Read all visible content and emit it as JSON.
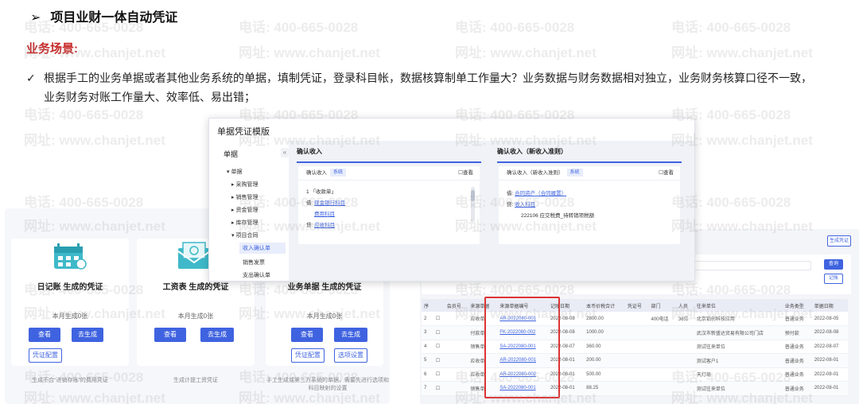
{
  "section_title": "项目业财一体自动凭证",
  "section_arrow": "➢",
  "biz_scene_label": "业务场景:",
  "bullet_check": "✓",
  "bullet_line1": "根据手工的业务单据或者其他业务系统的单据，填制凭证，登录科目帐，数据核算制单工作量大？业务数据与财务数据相对独立，业务财务核算口径不一致，",
  "bullet_line2": "业务财务对账工作量大、效率低、易出错；",
  "watermark": {
    "phone": "电话: 400-665-0028",
    "url": "网址: www.chanjet.net"
  },
  "dialog": {
    "title": "单据凭证模版",
    "sidebar_header": "单据",
    "collapse_glyph": "«",
    "tree": [
      "▾ 单据",
      "▸ 采购管理",
      "▸ 销售管理",
      "▸ 资金管理",
      "▸ 库存管理",
      "▾ 项目合同",
      "收入确认单",
      "销售发票",
      "支出确认单"
    ],
    "left_pane": {
      "title": "确认收入",
      "head_label": "确认收入",
      "tag": "系统",
      "view": "☐查看",
      "entries": {
        "e1": "1  「收款单」",
        "e2_prefix": "借: ",
        "e2_link": "现金银行科目",
        "e3_link": "费用科目",
        "e4_prefix": "贷: ",
        "e4_link": "应收科目"
      }
    },
    "right_pane": {
      "title": "确认收入（新收入准则）",
      "head_label": "确认收入（新收入准则）",
      "tag": "系统",
      "view": "☐查看",
      "entries": {
        "e1_prefix": "借: ",
        "e1_link": "合同资产（合同履置）",
        "e2_prefix": "贷: ",
        "e2_link": "收入科目",
        "e3": "222106 应交税费_待转销项税额"
      }
    }
  },
  "cards": [
    {
      "title": "日记账 生成的凭证",
      "count": "本月生成0张",
      "btn_view": "查看",
      "btn_gen": "去生成",
      "btn_config": "凭证配置",
      "note": "生成不合“进销存账”的费用凭证"
    },
    {
      "title": "工资表 生成的凭证",
      "count": "本月生成0张",
      "btn_view": "查看",
      "btn_gen": "去生成",
      "note": "生成计提工资凭证"
    },
    {
      "title": "业务单据 生成的凭证",
      "count": "本月生成0张",
      "btn_view": "查看",
      "btn_gen": "去生成",
      "btn_config": "凭证配置",
      "btn_option": "选项设置",
      "note": "手工生成或第三方系统的单据，需要先进行选项和科目映射的设置"
    }
  ],
  "table": {
    "topbar_btn1": "生成凭证",
    "topbar_btn2": "查询",
    "topbar_btn3": "记账",
    "headers": [
      "序",
      "",
      "会员号",
      "来源单据",
      "来源单据编号",
      "记账日期",
      "本币价税合计",
      "凭证号",
      "部门",
      "人员",
      "往来单位",
      "业务类型",
      "单据日期"
    ],
    "rows": [
      [
        "2",
        "☐",
        "",
        "应收单",
        "AR-2022080-001",
        "2022-08-08",
        "2800.00",
        "",
        "400电话",
        "36位",
        "北京铂创科技应用",
        "普通业务",
        "2022-08-05"
      ],
      [
        "3",
        "☐",
        "",
        "付款单",
        "FK-2022080-002",
        "2022-08-08",
        "1000.00",
        "",
        "",
        "",
        "武汉市新盛达贸易有限公司门店",
        "预付款",
        "2022-08-08"
      ],
      [
        "4",
        "☐",
        "",
        "销售单",
        "SA-2022080-001",
        "2022-08-07",
        "360.00",
        "",
        "",
        "",
        "测试往来单位",
        "普通业务",
        "2022-08-07"
      ],
      [
        "5",
        "☐",
        "",
        "应收单",
        "AR-2022080-001",
        "2022-08-01",
        "200.00",
        "",
        "",
        "",
        "测试客户1",
        "普通业务",
        "2022-08-01"
      ],
      [
        "6",
        "☐",
        "",
        "应收单",
        "AR-2022080-002",
        "2022-08-01",
        "500.00",
        "",
        "",
        "",
        "天灯局",
        "普通业务",
        "2022-08-01"
      ],
      [
        "7",
        "☐",
        "",
        "销售单",
        "SA-2022080-001",
        "2022-08-01",
        "88.25",
        "",
        "",
        "",
        "测试往来单位",
        "普通业务",
        "2022-08-01"
      ]
    ]
  }
}
